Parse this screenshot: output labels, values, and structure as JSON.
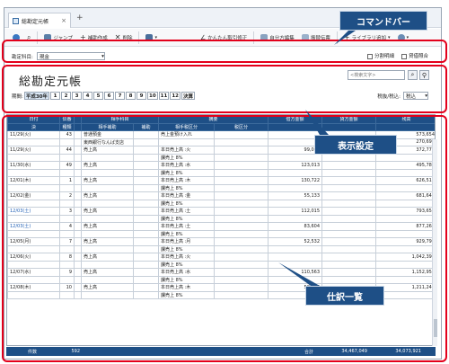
{
  "tab": {
    "label": "総勘定元帳",
    "close": "×",
    "add": "+"
  },
  "toolbar": {
    "jump": "ジャンプ",
    "add_journal": "補助作成",
    "delete": "削除",
    "easy_correction": "かんたん取引修正",
    "custom_edit": "自分方編集",
    "copy_transfer": "振替伝票",
    "library": "ライブラリ追加"
  },
  "callouts": {
    "command_bar": "コマンドバー",
    "display_settings": "表示設定",
    "journal_list": "仕訳一覧"
  },
  "filter": {
    "account_label": "勘定科目:",
    "account_value": "現金",
    "check1": "分割明細",
    "check2": "貸借照合",
    "title": "総勘定元帳",
    "search_placeholder": "<検索文字>",
    "period_label": "期間:",
    "period_start": "平成30年",
    "months": [
      "1",
      "2",
      "3",
      "4",
      "5",
      "6",
      "7",
      "8",
      "9",
      "10",
      "11",
      "12",
      "決算"
    ],
    "tax_label": "税抜/税込:",
    "tax_value": "税込"
  },
  "columns": {
    "top": [
      "日付",
      "伝番",
      "",
      "相手科目",
      "",
      "摘要",
      "",
      "借方金額",
      "貸方金額",
      "残高"
    ],
    "sub": [
      "決",
      "種類",
      "",
      "相手補助",
      "補助",
      "相手税区分",
      "税区分",
      "",
      "",
      ""
    ]
  },
  "rows": [
    {
      "date": "11/29(火)",
      "no": "43",
      "acct": "普通預金",
      "desc": "売上金預け入れ",
      "debit": "",
      "credit": "",
      "bal": "573,654"
    },
    {
      "date": "",
      "no": "",
      "acct": "東西銀行なんば支店",
      "desc": "",
      "debit": "",
      "credit": "",
      "bal": "270,694"
    },
    {
      "date": "11/29(火)",
      "no": "44",
      "acct": "売上高",
      "desc": "本日売上高 :火",
      "debit": "99,082",
      "credit": "",
      "bal": "372,776"
    },
    {
      "date": "",
      "no": "",
      "acct": "",
      "desc": "課売上 8%",
      "debit": "",
      "credit": "",
      "bal": ""
    },
    {
      "date": "11/30(水)",
      "no": "49",
      "acct": "売上高",
      "desc": "本日売上高 :水",
      "debit": "123,013",
      "credit": "",
      "bal": "495,789"
    },
    {
      "date": "",
      "no": "",
      "acct": "",
      "desc": "課売上 8%",
      "debit": "",
      "credit": "",
      "bal": ""
    },
    {
      "date": "12/01(木)",
      "no": "1",
      "acct": "売上高",
      "desc": "本日売上高 :木",
      "debit": "130,722",
      "credit": "",
      "bal": "626,511"
    },
    {
      "date": "",
      "no": "",
      "acct": "",
      "desc": "課売上 8%",
      "debit": "",
      "credit": "",
      "bal": ""
    },
    {
      "date": "12/02(金)",
      "no": "2",
      "acct": "売上高",
      "desc": "本日売上高 :金",
      "debit": "55,133",
      "credit": "",
      "bal": "681,644"
    },
    {
      "date": "",
      "no": "",
      "acct": "",
      "desc": "課売上 8%",
      "debit": "",
      "credit": "",
      "bal": ""
    },
    {
      "date": "12/03(土)",
      "no": "3",
      "acct": "売上高",
      "desc": "本日売上高 :土",
      "debit": "112,015",
      "credit": "",
      "bal": "793,659",
      "blue": true
    },
    {
      "date": "",
      "no": "",
      "acct": "",
      "desc": "課売上 8%",
      "debit": "",
      "credit": "",
      "bal": ""
    },
    {
      "date": "12/03(土)",
      "no": "4",
      "acct": "売上高",
      "desc": "本日売上高 :土",
      "debit": "83,604",
      "credit": "",
      "bal": "877,263",
      "blue": true
    },
    {
      "date": "",
      "no": "",
      "acct": "",
      "desc": "課売上 8%",
      "debit": "",
      "credit": "",
      "bal": ""
    },
    {
      "date": "12/05(月)",
      "no": "7",
      "acct": "売上高",
      "desc": "本日売上高 :月",
      "debit": "52,532",
      "credit": "",
      "bal": "929,795"
    },
    {
      "date": "",
      "no": "",
      "acct": "",
      "desc": "課売上 8%",
      "debit": "",
      "credit": "",
      "bal": ""
    },
    {
      "date": "12/06(火)",
      "no": "8",
      "acct": "売上高",
      "desc": "本日売上高 :火",
      "debit": "",
      "credit": "",
      "bal": "1,042,390"
    },
    {
      "date": "",
      "no": "",
      "acct": "",
      "desc": "課売上 8%",
      "debit": "",
      "credit": "",
      "bal": ""
    },
    {
      "date": "12/07(水)",
      "no": "9",
      "acct": "売上高",
      "desc": "本日売上高 :水",
      "debit": "110,563",
      "credit": "",
      "bal": "1,152,953"
    },
    {
      "date": "",
      "no": "",
      "acct": "",
      "desc": "課売上 8%",
      "debit": "",
      "credit": "",
      "bal": ""
    },
    {
      "date": "12/08(木)",
      "no": "10",
      "acct": "売上高",
      "desc": "本日売上高 :木",
      "debit": "58,295",
      "credit": "",
      "bal": "1,211,248"
    },
    {
      "date": "",
      "no": "",
      "acct": "",
      "desc": "課売上 8%",
      "debit": "",
      "credit": "",
      "bal": ""
    }
  ],
  "footer": {
    "count_label": "件数",
    "count": "592",
    "total_label": "合計",
    "debit_total": "34,467,049",
    "credit_total": "34,073,921"
  }
}
